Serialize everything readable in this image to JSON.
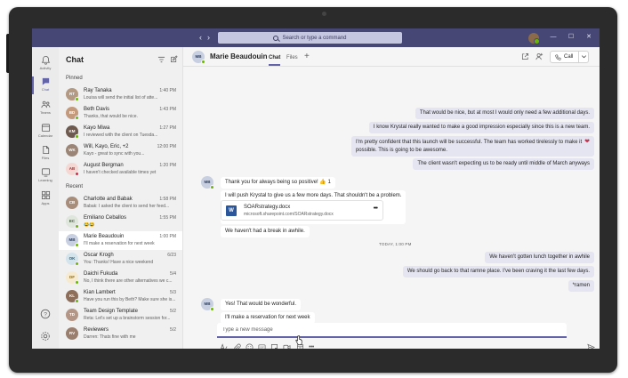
{
  "window": {
    "search_placeholder": "Search or type a command",
    "colors": {
      "titlebar": "#464775",
      "brand": "#6264a7",
      "presence_available": "#6bb700",
      "my_bubble": "#e5e5f1"
    },
    "controls": [
      "minimize-icon",
      "maximize-icon",
      "close-icon"
    ]
  },
  "rail": {
    "items": [
      {
        "label": "Activity",
        "icon": "bell-icon"
      },
      {
        "label": "Chat",
        "icon": "chat-icon",
        "active": true
      },
      {
        "label": "Teams",
        "icon": "teams-icon"
      },
      {
        "label": "Calendar",
        "icon": "calendar-icon"
      },
      {
        "label": "Files",
        "icon": "file-icon"
      },
      {
        "label": "Learning",
        "icon": "learning-icon"
      },
      {
        "label": "Apps",
        "icon": "apps-icon"
      }
    ],
    "bottom_icons": [
      "help-icon",
      "settings-icon"
    ]
  },
  "chat_list": {
    "title": "Chat",
    "pinned_label": "Pinned",
    "recent_label": "Recent",
    "pinned": [
      {
        "name": "Ray Tanaka",
        "time": "1:40 PM",
        "preview": "Louisa will send the initial list of atte...",
        "initials": "RT",
        "presence": "#6bb700"
      },
      {
        "name": "Beth Davis",
        "time": "1:43 PM",
        "preview": "Thanks, that would be nice.",
        "initials": "BD",
        "presence": "#6bb700"
      },
      {
        "name": "Kayo Miwa",
        "time": "1:27 PM",
        "preview": "I reviewed with the client on Tuesda...",
        "initials": "KM",
        "presence": "#6bb700"
      },
      {
        "name": "Will, Kayo, Eric, +2",
        "time": "12:00 PM",
        "preview": "Kayo - great to sync with you...",
        "initials": "WK",
        "presence": ""
      },
      {
        "name": "August Bergman",
        "time": "1:20 PM",
        "preview": "I haven't checked available times yet",
        "initials": "AB",
        "presence": "#c4314b"
      }
    ],
    "recent": [
      {
        "name": "Charlotte and Babak",
        "time": "1:58 PM",
        "preview": "Babak: I asked the client to send her feed...",
        "initials": "CB",
        "presence": ""
      },
      {
        "name": "Emiliano Ceballos",
        "time": "1:55 PM",
        "preview": "😂😂",
        "initials": "EC",
        "presence": "#6bb700"
      },
      {
        "name": "Marie Beaudouin",
        "time": "1:00 PM",
        "preview": "I'll make a reservation for next week",
        "initials": "MB",
        "presence": "#6bb700",
        "selected": true
      },
      {
        "name": "Oscar Krogh",
        "time": "6/23",
        "preview": "You: Thanks! Have a nice weekend",
        "initials": "OK",
        "presence": "#6bb700"
      },
      {
        "name": "Daichi Fukuda",
        "time": "5/4",
        "preview": "No, I think there are other alternatives we c...",
        "initials": "DF",
        "presence": "#6bb700"
      },
      {
        "name": "Kian Lambert",
        "time": "5/3",
        "preview": "Have you run this by Beth? Make sure she is...",
        "initials": "KL",
        "presence": "#6bb700"
      },
      {
        "name": "Team Design Template",
        "time": "5/2",
        "preview": "Reta: Let's set up a brainstorm session for...",
        "initials": "TD",
        "presence": ""
      },
      {
        "name": "Reviewers",
        "time": "5/2",
        "preview": "Darren: Thats fine with me",
        "initials": "RV",
        "presence": ""
      }
    ]
  },
  "conversation": {
    "contact_name": "Marie Beaudouin",
    "contact_initials": "MB",
    "tabs": [
      "Chat",
      "Files"
    ],
    "add_tab": "+",
    "call_label": "Call",
    "messages_mine": [
      "That would be nice, but at most I would only need a few additional days.",
      "I know Krystal really wanted to make a good impression especially since this is a new team.",
      "I'm pretty confident that this launch will be successful. The team has worked tirelessly to make it",
      "possible. This is going to be awesome.",
      "The client wasn't expecting us to be ready until middle of March anyways"
    ],
    "messages_theirs_1": [
      "Thank you for always being so positive! 👍 1",
      "I will push Krystal to give us a few more days. That shouldn't be a problem.",
      "We haven't had a break in awhile."
    ],
    "file": {
      "name": "SOARstrategy.docx",
      "url": "microsoft.sharepoint.com/SOARstrategy.docx",
      "type_letter": "W"
    },
    "timestamp_divider": "TODAY, 1:00 PM",
    "messages_mine_2": [
      "We haven't gotten lunch together in awhile",
      "We should go back to that ramne place. I've been craving it the last few days.",
      "*ramen"
    ],
    "messages_theirs_2": [
      "Yes! That would be wonderful.",
      "I'll make a reservation for next week"
    ],
    "compose_placeholder": "Type a new message",
    "compose_tools": [
      "format-icon",
      "attach-icon",
      "emoji-icon",
      "gif-icon",
      "sticker-icon",
      "meet-now-icon",
      "schedule-icon",
      "more-icon"
    ]
  }
}
